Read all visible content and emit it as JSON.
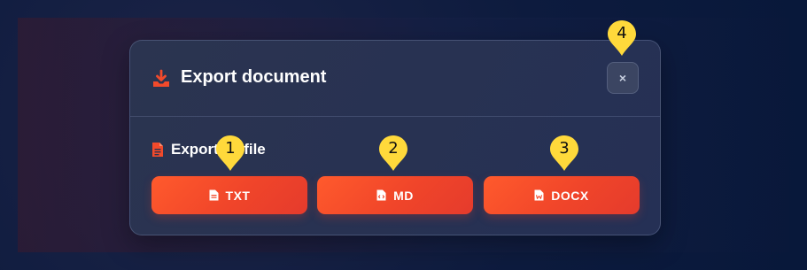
{
  "dialog": {
    "title": "Export document",
    "close_label": "×",
    "section_label": "Export as file"
  },
  "buttons": [
    {
      "label": "TXT",
      "icon": "file-text-icon"
    },
    {
      "label": "MD",
      "icon": "file-code-icon"
    },
    {
      "label": "DOCX",
      "icon": "file-word-icon"
    }
  ],
  "markers": [
    "1",
    "2",
    "3",
    "4"
  ],
  "colors": {
    "accent": "#f24a2b",
    "marker": "#ffd93b",
    "dialog_bg": "#293350",
    "background": "#0b1a3a"
  }
}
